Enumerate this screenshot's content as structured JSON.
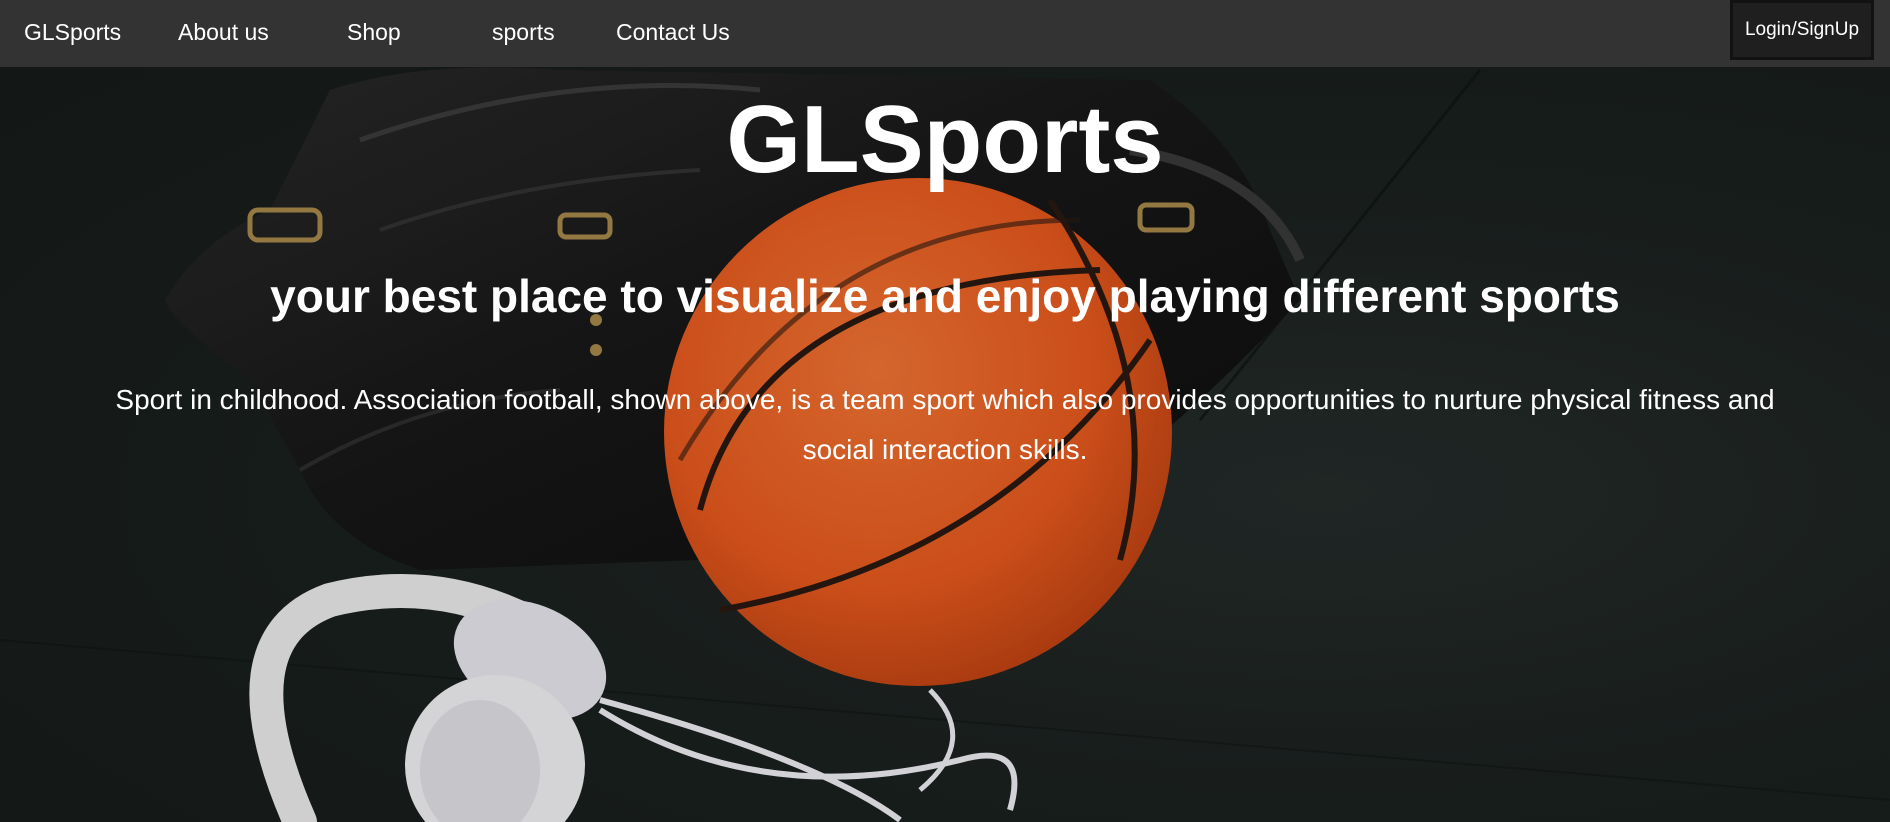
{
  "nav": {
    "brand": "GLSports",
    "links": [
      "About us",
      "Shop",
      "sports",
      "Contact Us"
    ],
    "login_label": "Login/SignUp"
  },
  "hero": {
    "title": "GLSports",
    "subtitle": "your best place to visualize and enjoy playing different sports",
    "description": "Sport in childhood. Association football, shown above, is a team sport which also provides opportunities to nurture physical fitness and social interaction skills."
  },
  "colors": {
    "navbar": "#333333",
    "login_button": "#1f1f1f",
    "ball": "#ec5b20",
    "background": "#1b211f"
  },
  "background_image": {
    "objects": [
      "black-leather-bag",
      "basketball",
      "white-headphones"
    ]
  }
}
